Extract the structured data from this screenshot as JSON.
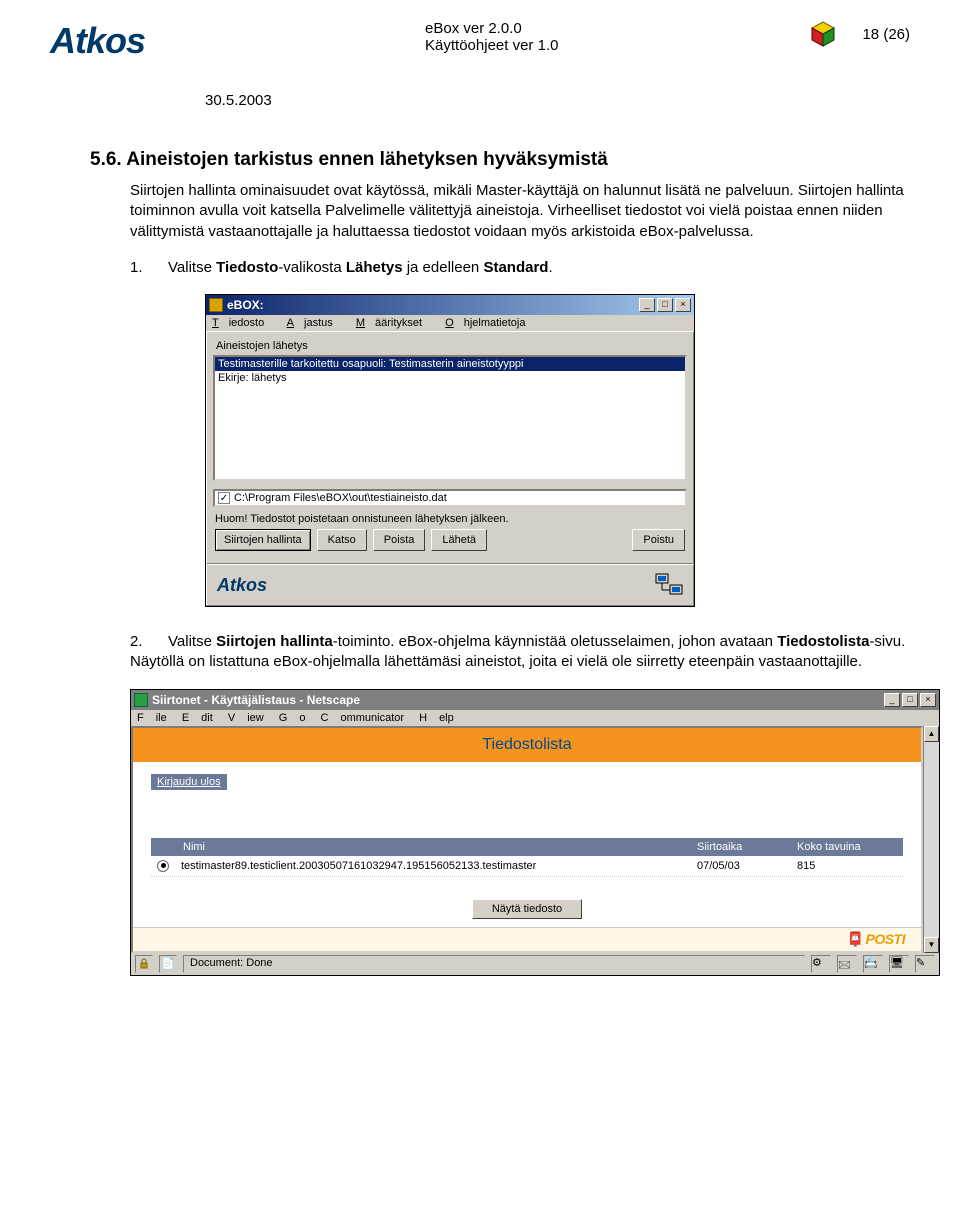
{
  "header": {
    "logo": "Atkos",
    "product": "eBox ver 2.0.0",
    "manual": "Käyttöohjeet ver 1.0",
    "page": "18 (26)",
    "date": "30.5.2003"
  },
  "section": {
    "number": "5.6.",
    "title": "Aineistojen tarkistus ennen lähetyksen hyväksymistä"
  },
  "para1": "Siirtojen hallinta ominaisuudet ovat käytössä, mikäli Master-käyttäjä on halunnut lisätä ne palveluun. Siirtojen hallinta toiminnon avulla voit katsella Palvelimelle välitettyjä aineistoja. Virheelliset tiedostot voi vielä poistaa ennen niiden välittymistä vastaanottajalle ja haluttaessa tiedostot voidaan myös arkistoida eBox-palvelussa.",
  "step1": {
    "num": "1.",
    "text_a": "Valitse ",
    "b1": "Tiedosto",
    "text_b": "-valikosta ",
    "b2": "Lähetys",
    "text_c": " ja edelleen ",
    "b3": "Standard",
    "text_d": "."
  },
  "ebox": {
    "title": "eBOX:",
    "menu": {
      "m1": "Tiedosto",
      "m2": "Ajastus",
      "m3": "Määritykset",
      "m4": "Ohjelmatietoja"
    },
    "list_label": "Aineistojen lähetys",
    "rows": [
      "Testimasterille tarkoitettu osapuoli: Testimasterin aineistotyyppi",
      "Ekirje: lähetys"
    ],
    "file": "C:\\Program Files\\eBOX\\out\\testiaineisto.dat",
    "warn": "Huom! Tiedostot poistetaan onnistuneen lähetyksen jälkeen.",
    "buttons": {
      "b1": "Siirtojen hallinta",
      "b2": "Katso",
      "b3": "Poista",
      "b4": "Lähetä",
      "b5": "Poistu"
    },
    "footer_logo": "Atkos"
  },
  "step2": {
    "num": "2.",
    "text_a": "Valitse ",
    "b1": "Siirtojen hallinta",
    "text_b": "-toiminto. eBox-ohjelma käynnistää oletusselaimen, johon avataan ",
    "b2": "Tiedostolista",
    "text_c": "-sivu. Näytöllä on listattuna eBox-ohjelmalla lähettämäsi aineistot, joita ei vielä ole siirretty eteenpäin vastaanottajille."
  },
  "ns": {
    "title": "Siirtonet - Käyttäjälistaus - Netscape",
    "menu": {
      "m1": "File",
      "m2": "Edit",
      "m3": "View",
      "m4": "Go",
      "m5": "Communicator",
      "m6": "Help"
    },
    "heading": "Tiedostolista",
    "logout": "Kirjaudu ulos",
    "cols": {
      "c1": "Nimi",
      "c2": "Siirtoaika",
      "c3": "Koko tavuina"
    },
    "row": {
      "name": "testimaster89.testiclient.20030507161032947.195156052133.testimaster",
      "date": "07/05/03",
      "size": "815"
    },
    "show_btn": "Näytä tiedosto",
    "posti": "POSTI",
    "status": "Document: Done"
  }
}
